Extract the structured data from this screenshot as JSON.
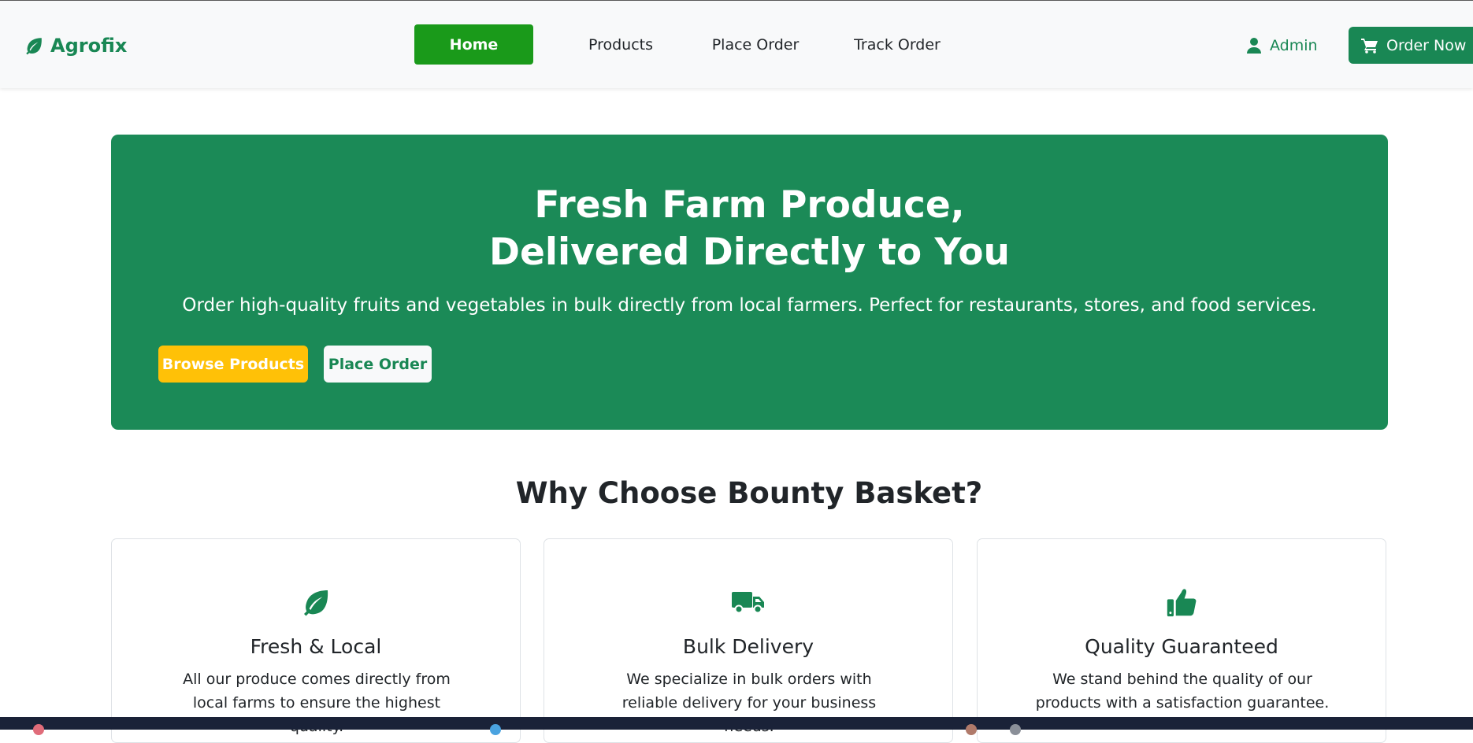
{
  "navbar": {
    "brand": "Agrofix",
    "links": [
      {
        "label": "Home",
        "active": true
      },
      {
        "label": "Products",
        "active": false
      },
      {
        "label": "Place Order",
        "active": false
      },
      {
        "label": "Track Order",
        "active": false
      }
    ],
    "admin_label": "Admin",
    "order_now_label": "Order Now",
    "icons": {
      "brand": "leaf-icon",
      "admin": "user-icon",
      "order": "cart-icon"
    }
  },
  "hero": {
    "title_line1": "Fresh Farm Produce,",
    "title_line2": "Delivered Directly to You",
    "subtitle": "Order high-quality fruits and vegetables in bulk directly from local farmers. Perfect for restaurants, stores, and food services.",
    "primary_button": "Browse Products",
    "secondary_button": "Place Order"
  },
  "why": {
    "title": "Why Choose Bounty Basket?",
    "cards": [
      {
        "icon": "leaf-icon",
        "title": "Fresh & Local",
        "text": "All our produce comes directly from local farms to ensure the highest quality."
      },
      {
        "icon": "truck-icon",
        "title": "Bulk Delivery",
        "text": "We specialize in bulk orders with reliable delivery for your business needs."
      },
      {
        "icon": "thumbs-up-icon",
        "title": "Quality Guaranteed",
        "text": "We stand behind the quality of our products with a satisfaction guarantee."
      }
    ]
  },
  "colors": {
    "brand_green": "#198754",
    "active_nav": "#1a9a1a",
    "hero_bg": "#1b8a57",
    "browse_button": "#ffc107"
  }
}
